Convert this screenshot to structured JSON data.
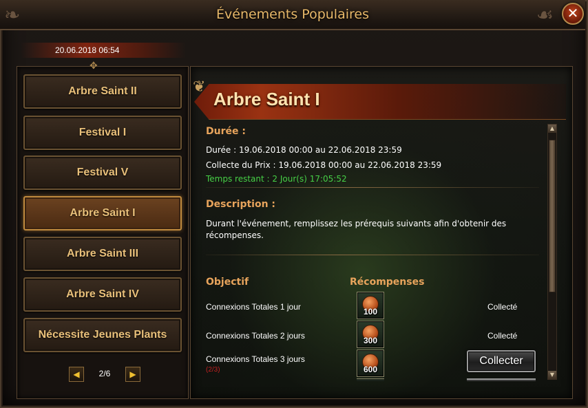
{
  "window": {
    "title": "Événements Populaires",
    "close_label": "✕"
  },
  "date": "20.06.2018 06:54",
  "sidebar": {
    "items": [
      {
        "label": "Arbre Saint II"
      },
      {
        "label": "Festival I"
      },
      {
        "label": "Festival V"
      },
      {
        "label": "Arbre Saint I"
      },
      {
        "label": "Arbre Saint III"
      },
      {
        "label": "Arbre Saint IV"
      },
      {
        "label": "Nécessite Jeunes Plants"
      }
    ],
    "active_index": 3,
    "pager": {
      "text": "2/6",
      "prev_icon": "◀",
      "next_icon": "▶"
    }
  },
  "detail": {
    "title": "Arbre Saint I",
    "duration_heading": "Durée :",
    "duration_line": "Durée : 19.06.2018 00:00 au 22.06.2018 23:59",
    "collect_line": "Collecte du Prix : 19.06.2018 00:00 au 22.06.2018 23:59",
    "remaining_line": "Temps restant : 2 Jour(s)  17:05:52",
    "description_heading": "Description :",
    "description_line1": "Durant l'événement, remplissez les prérequis suivants afin d'obtenir des",
    "description_line2": "récompenses.",
    "objective_heading": "Objectif",
    "rewards_heading": "Récompenses",
    "rows": [
      {
        "objective": "Connexions Totales 1 jour",
        "reward_qty": "100",
        "status": "Collecté"
      },
      {
        "objective": "Connexions Totales 2 jours",
        "reward_qty": "300",
        "status": "Collecté"
      },
      {
        "objective": "Connexions Totales 3 jours",
        "reward_qty": "600",
        "progress": "(2/3)",
        "button": "Collecter"
      }
    ]
  },
  "colors": {
    "accent": "#e8a45c",
    "remaining": "#46d046",
    "progress": "#c02020",
    "title": "#e8b96a"
  }
}
